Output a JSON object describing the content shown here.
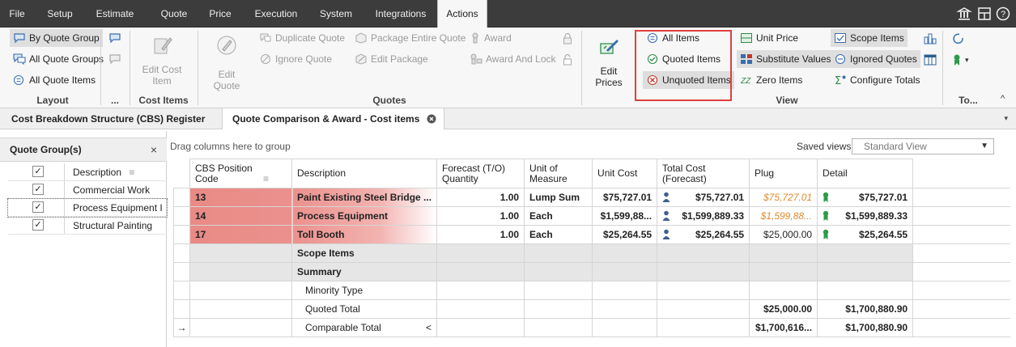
{
  "menu": {
    "items": [
      "File",
      "Setup",
      "Estimate",
      "Quote",
      "Price",
      "Execution",
      "System",
      "Integrations",
      "Actions"
    ],
    "active": "Actions"
  },
  "ribbon": {
    "layout": {
      "by_quote_group": "By Quote Group",
      "all_quote_groups": "All Quote Groups",
      "all_quote_items": "All Quote Items",
      "label": "Layout"
    },
    "more_label": "...",
    "cost_items": {
      "edit_cost_item": "Edit Cost Item",
      "label": "Cost Items"
    },
    "quotes": {
      "edit_quote": "Edit Quote",
      "duplicate_quote": "Duplicate Quote",
      "ignore_quote": "Ignore Quote",
      "package_entire_quote": "Package Entire Quote",
      "edit_package": "Edit Package",
      "award": "Award",
      "award_and_lock": "Award And Lock",
      "label": "Quotes"
    },
    "edit_prices": "Edit Prices",
    "view": {
      "all_items": "All Items",
      "quoted_items": "Quoted Items",
      "unquoted_items": "Unquoted Items",
      "unit_price": "Unit Price",
      "substitute_values": "Substitute Values",
      "zero_items": "Zero Items",
      "scope_items": "Scope Items",
      "ignored_quotes": "Ignored Quotes",
      "configure_totals": "Configure Totals",
      "label": "View"
    },
    "tools_label": "To..."
  },
  "doc_tabs": {
    "register": "Cost Breakdown Structure (CBS) Register",
    "quote_comparison": "Quote Comparison & Award - Cost items"
  },
  "left_panel": {
    "title": "Quote Group(s)",
    "close": "×",
    "header_label": "Description",
    "rows": [
      {
        "label": "Commercial Work",
        "checked": true
      },
      {
        "label": "Process Equipment I...",
        "checked": true
      },
      {
        "label": "Structural Painting",
        "checked": true
      }
    ]
  },
  "grid": {
    "group_hint": "Drag columns here to group",
    "saved_views_label": "Saved views:",
    "saved_view_value": "Standard View",
    "columns": {
      "cbs": "CBS Position Code",
      "description": "Description",
      "forecast_qty": "Forecast (T/O) Quantity",
      "uom": "Unit of Measure",
      "unit_cost": "Unit Cost",
      "total_cost": "Total Cost (Forecast)",
      "plug": "Plug",
      "detail": "Detail"
    },
    "rows": [
      {
        "cbs": "13",
        "description": "Paint Existing Steel Bridge ...",
        "qty": "1.00",
        "uom": "Lump Sum",
        "unit_cost": "$75,727.01",
        "total": "$75,727.01",
        "plug": "$75,727.01",
        "detail": "$75,727.01"
      },
      {
        "cbs": "14",
        "description": "Process Equipment",
        "qty": "1.00",
        "uom": "Each",
        "unit_cost": "$1,599,88...",
        "total": "$1,599,889.33",
        "plug": "$1,599,88...",
        "detail": "$1,599,889.33"
      },
      {
        "cbs": "17",
        "description": "Toll Booth",
        "qty": "1.00",
        "uom": "Each",
        "unit_cost": "$25,264.55",
        "total": "$25,264.55",
        "plug": "$25,000.00",
        "detail": "$25,264.55"
      }
    ],
    "scope_items": "Scope Items",
    "summary": "Summary",
    "minority_type": "Minority Type",
    "quoted_total": {
      "label": "Quoted Total",
      "plug": "$25,000.00",
      "detail": "$1,700,880.90"
    },
    "comparable_total": {
      "label": "Comparable Total",
      "marker": "<",
      "plug": "$1,700,616...",
      "detail": "$1,700,880.90"
    },
    "current_row_marker": "→"
  },
  "colors": {
    "cbs_highlight": "#e98a86",
    "plug_italic": "#e08a2c",
    "menubar": "#3c3c3c",
    "highlight_box": "#e04040"
  }
}
